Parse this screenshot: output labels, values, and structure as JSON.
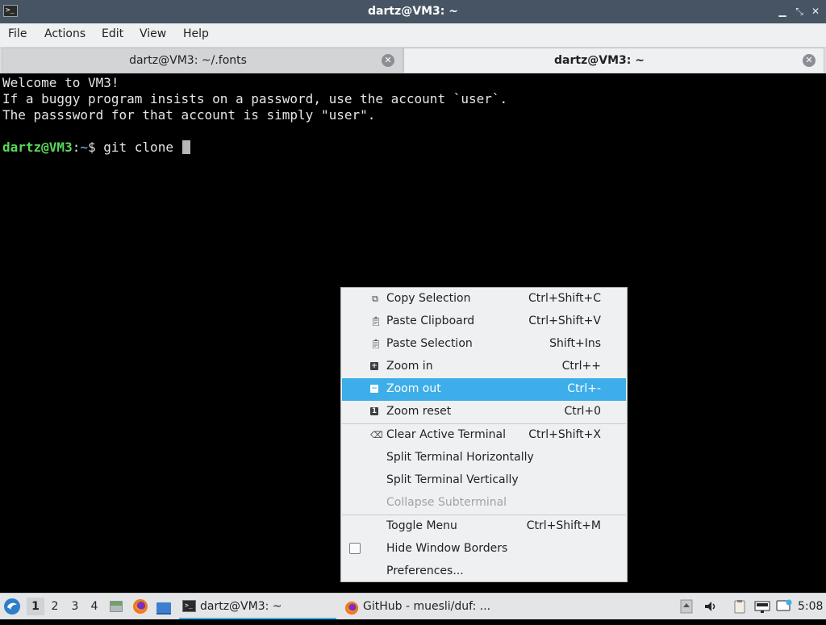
{
  "window": {
    "title": "dartz@VM3: ~",
    "app_icon": "terminal-icon",
    "controls": [
      "minimize-icon",
      "maximize-icon",
      "close-icon"
    ]
  },
  "menubar": {
    "items": [
      "File",
      "Actions",
      "Edit",
      "View",
      "Help"
    ]
  },
  "tabs": [
    {
      "label": "dartz@VM3: ~/.fonts",
      "active": false
    },
    {
      "label": "dartz@VM3: ~",
      "active": true
    }
  ],
  "terminal": {
    "lines": [
      "Welcome to VM3!",
      "If a buggy program insists on a password, use the account `user`.",
      "The passsword for that account is simply \"user\"."
    ],
    "prompt": {
      "user_host": "dartz@VM3",
      "colon": ":",
      "path": "~",
      "symbol": "$",
      "command": " git clone "
    },
    "colors": {
      "prompt_user": "#5ad75a",
      "prompt_path": "#6f8bd8",
      "text": "#e6e6e6"
    }
  },
  "context_menu": {
    "groups": [
      [
        {
          "label": "Copy Selection",
          "shortcut": "Ctrl+Shift+C",
          "icon": "copy-icon"
        },
        {
          "label": "Paste Clipboard",
          "shortcut": "Ctrl+Shift+V",
          "icon": "paste-icon"
        },
        {
          "label": "Paste Selection",
          "shortcut": "Shift+Ins",
          "icon": "paste-icon"
        },
        {
          "label": "Zoom in",
          "shortcut": "Ctrl++",
          "icon": "zoom-in-icon"
        },
        {
          "label": "Zoom out",
          "shortcut": "Ctrl+-",
          "icon": "zoom-out-icon",
          "highlighted": true
        },
        {
          "label": "Zoom reset",
          "shortcut": "Ctrl+0",
          "icon": "zoom-reset-icon"
        }
      ],
      [
        {
          "label": "Clear Active Terminal",
          "shortcut": "Ctrl+Shift+X",
          "icon": "clear-icon"
        },
        {
          "label": "Split Terminal Horizontally",
          "shortcut": ""
        },
        {
          "label": "Split Terminal Vertically",
          "shortcut": ""
        },
        {
          "label": "Collapse Subterminal",
          "shortcut": "",
          "disabled": true
        }
      ],
      [
        {
          "label": "Toggle Menu",
          "shortcut": "Ctrl+Shift+M"
        },
        {
          "label": "Hide Window Borders",
          "shortcut": "",
          "checkbox": false
        },
        {
          "label": "Preferences...",
          "shortcut": ""
        }
      ]
    ],
    "highlight_color": "#3daee9"
  },
  "taskbar": {
    "start_icon": "lxqt-start-icon",
    "workspaces": [
      "1",
      "2",
      "3",
      "4"
    ],
    "active_workspace": "1",
    "launchers": [
      "file-manager-icon",
      "firefox-icon",
      "desktop-icon"
    ],
    "tasks": [
      {
        "label": "dartz@VM3: ~",
        "icon": "terminal-icon",
        "active": true
      },
      {
        "label": "GitHub - muesli/duf: ...",
        "icon": "firefox-icon",
        "active": false
      }
    ],
    "tray_icons": [
      "volume-icon",
      "clipboard-icon",
      "network-icon",
      "notification-icon"
    ],
    "clock": "5:08"
  }
}
